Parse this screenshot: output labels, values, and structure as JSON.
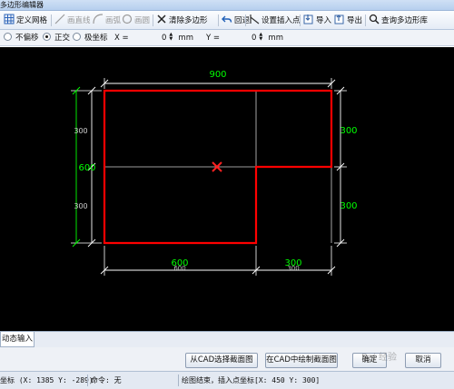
{
  "window": {
    "title": "多边形编辑器"
  },
  "toolbar": {
    "define_grid": "定义网格",
    "draw_line": "画直线",
    "draw_arc": "画弧",
    "draw_circle": "画圆",
    "clear_polygon": "清除多边形",
    "undo": "回退",
    "set_insert_point": "设置插入点",
    "import": "导入",
    "export": "导出",
    "query_library": "查询多边形库"
  },
  "options": {
    "no_offset": "不偏移",
    "orthogonal": "正交",
    "polar": "极坐标",
    "selected": "正交",
    "x_label": "X =",
    "x_value": "0",
    "y_label": "Y =",
    "y_value": "0",
    "unit": "mm"
  },
  "drawing": {
    "dim_top": "900",
    "dim_left_top": "300",
    "dim_left_bottom": "300",
    "dim_left_total": "600",
    "dim_right_top": "300",
    "dim_right_bottom": "300",
    "dim_bottom_left": "600",
    "dim_bottom_left_ghost": "600",
    "dim_bottom_right": "300",
    "dim_bottom_right_ghost": "300",
    "colors": {
      "polygon": "#ff0000",
      "dimension_text": "#00ff00",
      "dimension_text_dim": "#cfcfcf",
      "grid": "#d8d8d8",
      "background": "#000000"
    }
  },
  "tabs": {
    "dynamic_input": "动态输入"
  },
  "buttons": {
    "select_from_cad": "从CAD选择截面图",
    "draw_in_cad": "在CAD中绘制截面图",
    "ok": "确定",
    "cancel": "取消"
  },
  "status": {
    "coords": "坐标 (X: 1385 Y: -289)",
    "command": "命令: 无",
    "message": "绘图结束，插入点坐标[X: 450 Y: 300]"
  },
  "watermark": "Bai 经验"
}
